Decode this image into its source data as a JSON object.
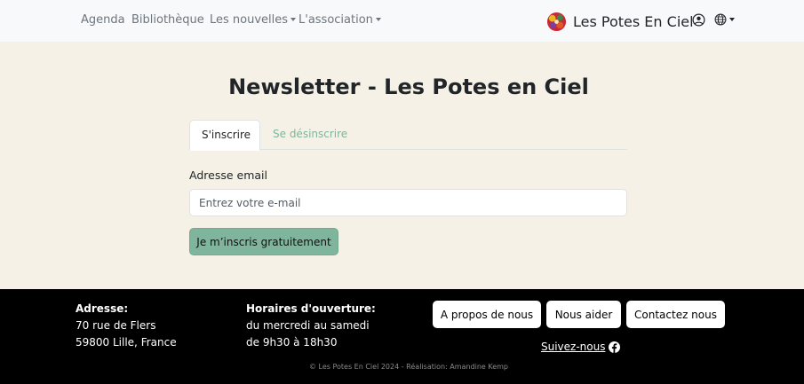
{
  "nav": {
    "agenda": "Agenda",
    "library": "Bibliothèque",
    "news": "Les nouvelles",
    "association": "L'association",
    "brand": "Les Potes En Ciel"
  },
  "icons": {
    "logo": "brand-logo",
    "user": "user-circle-icon",
    "language": "globe-icon",
    "facebook": "facebook-icon"
  },
  "colors": {
    "accent": "#7fb59c",
    "background": "#f5f1e6",
    "footer": "#000000"
  },
  "main": {
    "title": "Newsletter - Les Potes en Ciel",
    "tabs": [
      {
        "label": "S'inscrire",
        "active": true
      },
      {
        "label": "Se désinscrire",
        "active": false
      }
    ],
    "email_label": "Adresse email",
    "email_placeholder": "Entrez votre e-mail",
    "email_value": "",
    "submit_label": "Je m’inscris gratuitement"
  },
  "footer": {
    "address_heading": "Adresse:",
    "address_line1": "70 rue de Flers",
    "address_line2": "59800 Lille, France",
    "hours_heading": "Horaires d'ouverture:",
    "hours_line1": "du mercredi au samedi",
    "hours_line2": "de 9h30 à 18h30",
    "about_button": "A propos de nous",
    "help_button": "Nous aider",
    "contact_button": "Contactez nous",
    "follow_link": "Suivez-nous",
    "copyright": "© Les Potes En Ciel 2024 - Réalisation: Amandine Kemp"
  }
}
